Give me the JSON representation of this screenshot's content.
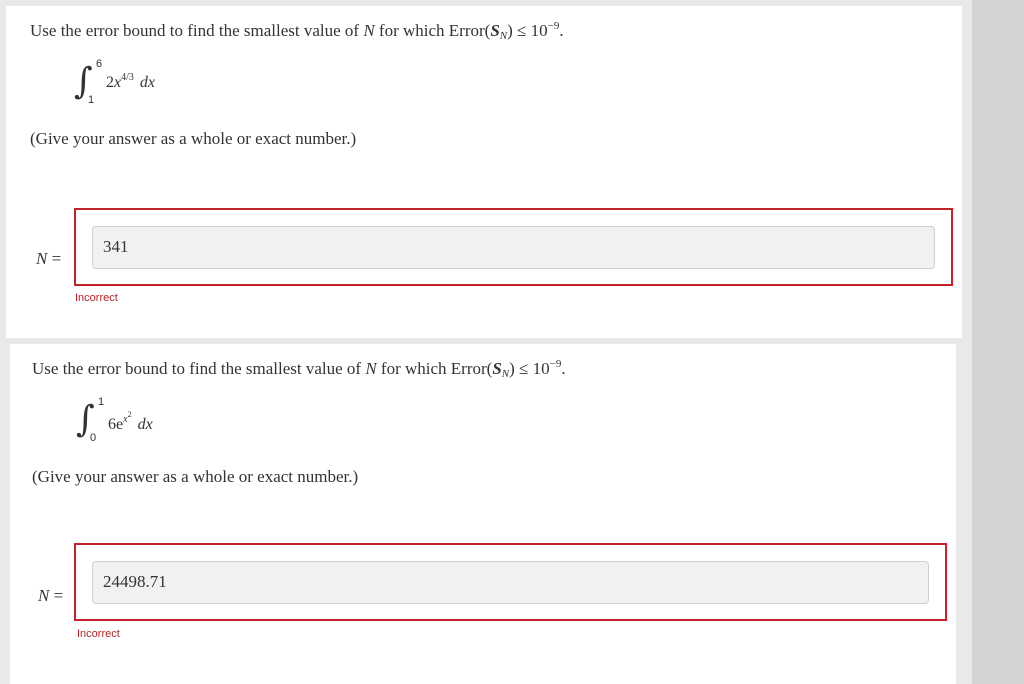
{
  "questions": [
    {
      "prompt_prefix": "Use the error bound to find the smallest value of ",
      "prompt_var": "N",
      "prompt_mid": " for which Error(",
      "prompt_s": "S",
      "prompt_sub": "N",
      "prompt_close": ") ≤ 10",
      "prompt_exp": "−9",
      "prompt_end": ".",
      "integral": {
        "upper": "6",
        "lower": "1",
        "coef": "2",
        "var": "x",
        "exp": "4/3",
        "dx": "dx"
      },
      "hint": "(Give your answer as a whole or exact number.)",
      "answer_label_var": "N",
      "answer_label_eq": " =",
      "answer_value": "341",
      "status": "Incorrect"
    },
    {
      "prompt_prefix": "Use the error bound to find the smallest value of ",
      "prompt_var": "N",
      "prompt_mid": " for which Error(",
      "prompt_s": "S",
      "prompt_sub": "N",
      "prompt_close": ") ≤ 10",
      "prompt_exp": "−9",
      "prompt_end": ".",
      "integral": {
        "upper": "1",
        "lower": "0",
        "coef": "6",
        "base": "e",
        "exp_var": "x",
        "exp_pow": "2",
        "dx": "dx"
      },
      "hint": "(Give your answer as a whole or exact number.)",
      "answer_label_var": "N",
      "answer_label_eq": " =",
      "answer_value": "24498.71",
      "status": "Incorrect"
    }
  ],
  "colors": {
    "error_border": "#c4232d",
    "status_text": "#b0262b",
    "input_bg": "#f1f1f1"
  }
}
